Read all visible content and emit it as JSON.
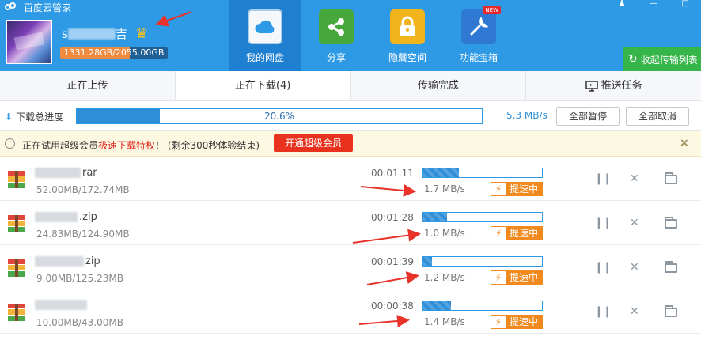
{
  "app": {
    "title": "百度云管家",
    "window_controls": [
      "♟",
      "—",
      "□"
    ]
  },
  "user": {
    "name_visible_start": "s",
    "name_visible_end": "吉",
    "quota_text": "1331.28GB/2055.00GB",
    "quota_used_fraction": 0.648
  },
  "nav": [
    {
      "label": "我的网盘",
      "icon": "cloud-icon",
      "active": true
    },
    {
      "label": "分享",
      "icon": "share-icon",
      "active": false
    },
    {
      "label": "隐藏空间",
      "icon": "lock-icon",
      "active": false
    },
    {
      "label": "功能宝箱",
      "icon": "toolbox-icon",
      "active": false,
      "badge": "NEW"
    }
  ],
  "collapse_label": "收起传输列表",
  "tabs": [
    {
      "label": "正在上传",
      "active": false
    },
    {
      "label": "正在下载(4)",
      "active": true
    },
    {
      "label": "传输完成",
      "active": false
    },
    {
      "label": "推送任务",
      "active": false,
      "icon": "monitor-icon"
    }
  ],
  "total": {
    "label": "下载总进度",
    "percent_text": "20.6%",
    "fraction": 0.206,
    "speed": "5.3 MB/s",
    "pause_all": "全部暂停",
    "cancel_all": "全部取消"
  },
  "banner": {
    "prefix": "正在试用超级会员",
    "highlight": "极速下载特权",
    "suffix": "！ (剩余300秒体验结束)",
    "button": "开通超级会员",
    "close": "×"
  },
  "boost_label": "提速中",
  "rows": [
    {
      "name_suffix": "rar",
      "size": "52.00MB/172.74MB",
      "time": "00:01:11",
      "speed": "1.7 MB/s",
      "progress": 0.301
    },
    {
      "name_suffix": ".zip",
      "size": "24.83MB/124.90MB",
      "time": "00:01:28",
      "speed": "1.0 MB/s",
      "progress": 0.199
    },
    {
      "name_suffix": "zip",
      "size": "9.00MB/125.23MB",
      "time": "00:01:39",
      "speed": "1.2 MB/s",
      "progress": 0.072
    },
    {
      "name_suffix": "",
      "size": "10.00MB/43.00MB",
      "time": "00:00:38",
      "speed": "1.4 MB/s",
      "progress": 0.233
    }
  ],
  "colors": {
    "header": "#2e9ae6",
    "active_nav": "#1f7fd0",
    "progress": "#2e8fd8",
    "boost": "#f08a1e",
    "vip_button": "#e8321e",
    "annotation": "#e8322a"
  }
}
